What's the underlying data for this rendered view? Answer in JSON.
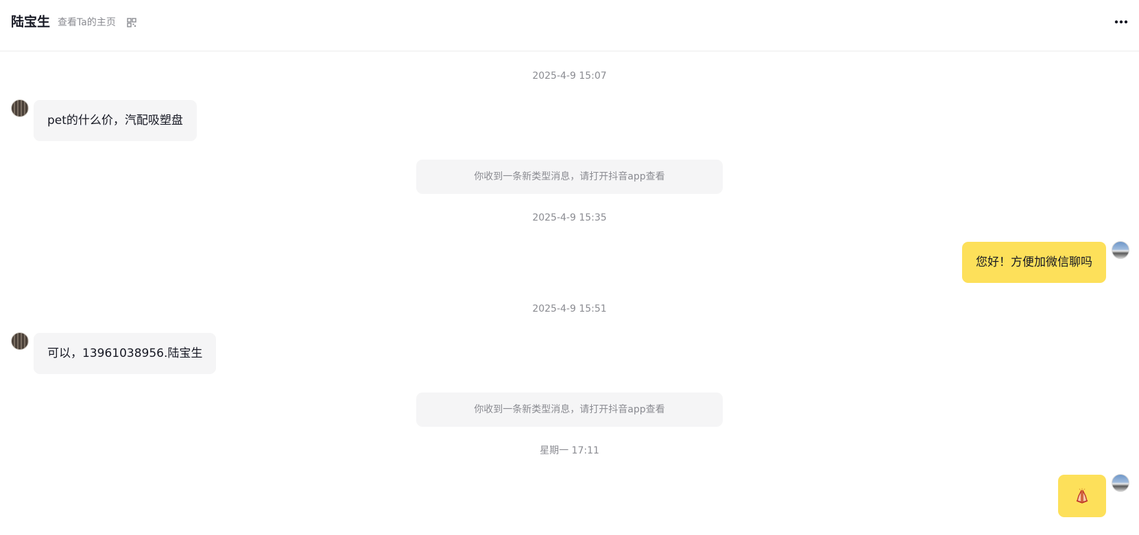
{
  "header": {
    "contact_name": "陆宝生",
    "profile_link": "查看Ta的主页",
    "qr_icon": "qr-code-icon",
    "more_icon": "more-horizontal-icon"
  },
  "messages": [
    {
      "type": "timestamp",
      "text": "2025-4-9 15:07"
    },
    {
      "type": "incoming",
      "text": "pet的什么价，汽配吸塑盘"
    },
    {
      "type": "system",
      "text": "你收到一条新类型消息，请打开抖音app查看"
    },
    {
      "type": "timestamp",
      "text": "2025-4-9 15:35"
    },
    {
      "type": "outgoing",
      "text": "您好！方便加微信聊吗"
    },
    {
      "type": "timestamp",
      "text": "2025-4-9 15:51"
    },
    {
      "type": "incoming",
      "text": "可以，13961038956.陆宝生"
    },
    {
      "type": "system",
      "text": "你收到一条新类型消息，请打开抖音app查看"
    },
    {
      "type": "timestamp",
      "text": "星期一 17:11"
    },
    {
      "type": "outgoing-sticker",
      "icon": "folded-hands-sticker-icon"
    }
  ],
  "colors": {
    "incoming_bubble": "#f5f5f6",
    "outgoing_bubble": "#fde05a",
    "muted_text": "#8a8b91",
    "primary_text": "#161823"
  }
}
